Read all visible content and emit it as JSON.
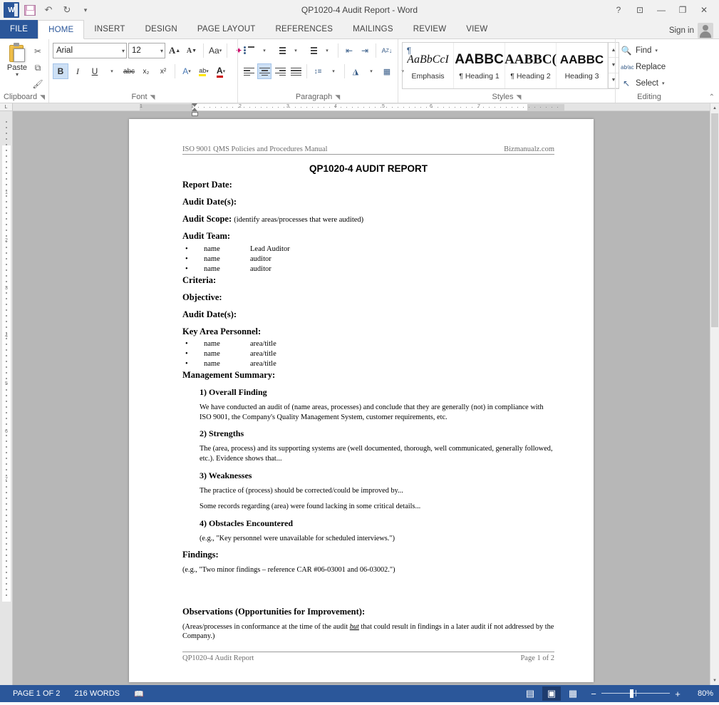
{
  "titlebar": {
    "app_logo": "word-logo",
    "title": "QP1020-4 Audit Report - Word",
    "quick_access": [
      {
        "name": "save-icon",
        "label": "Save"
      },
      {
        "name": "undo-icon",
        "label": "↶"
      },
      {
        "name": "redo-icon",
        "label": "↻"
      },
      {
        "name": "customize-qat-icon",
        "label": "⩒"
      }
    ],
    "window_controls": [
      {
        "name": "help-icon",
        "label": "?"
      },
      {
        "name": "ribbon-display-options-icon",
        "label": "⊡"
      },
      {
        "name": "minimize-icon",
        "label": "—"
      },
      {
        "name": "restore-icon",
        "label": "❐"
      },
      {
        "name": "close-icon",
        "label": "✕"
      }
    ]
  },
  "tabs": {
    "file": "FILE",
    "items": [
      "HOME",
      "INSERT",
      "DESIGN",
      "PAGE LAYOUT",
      "REFERENCES",
      "MAILINGS",
      "REVIEW",
      "VIEW"
    ],
    "active": "HOME",
    "sign_in": "Sign in"
  },
  "ribbon": {
    "clipboard": {
      "label": "Clipboard",
      "paste": "Paste",
      "paste_caret": "▾",
      "cut": "✂",
      "copy": "⧉",
      "format_painter": "🖌",
      "dialog_launcher": "◥"
    },
    "font": {
      "label": "Font",
      "font_name": "Arial",
      "font_size": "12",
      "grow_font": "A",
      "shrink_font": "A",
      "change_case": "Aa",
      "clear_formatting": "✐",
      "bold": "B",
      "italic": "I",
      "underline": "U",
      "strikethrough": "abc",
      "subscript": "x₂",
      "superscript": "x²",
      "text_effects": "A",
      "highlight": "ab",
      "font_color": "A",
      "dialog_launcher": "◥",
      "bold_active": true
    },
    "paragraph": {
      "label": "Paragraph",
      "bullets": "bullet-list-icon",
      "numbering": "numbered-list-icon",
      "multilevel": "multilevel-list-icon",
      "decrease_indent": "⇤",
      "increase_indent": "⇥",
      "sort": "A Z↓",
      "show_marks": "¶",
      "align_left": "align-left-icon",
      "align_center": "align-center-icon",
      "align_right": "align-right-icon",
      "justify": "justify-icon",
      "line_spacing": "line-spacing-icon",
      "shading": "shading-icon",
      "borders": "borders-icon",
      "dialog_launcher": "◥",
      "align_center_active": true
    },
    "styles": {
      "label": "Styles",
      "dialog_launcher": "◥",
      "items": [
        {
          "preview": "AaBbCcI",
          "name": "Emphasis",
          "kind": "emph"
        },
        {
          "preview": "AABBC",
          "name": "¶ Heading 1",
          "kind": "h1"
        },
        {
          "preview": "AABBC(",
          "name": "¶ Heading 2",
          "kind": "h2"
        },
        {
          "preview": "AABBC",
          "name": "Heading 3",
          "kind": "h3"
        }
      ],
      "scroll_up": "▲",
      "scroll_down": "▼",
      "more": "▼"
    },
    "editing": {
      "label": "Editing",
      "find": "Find",
      "find_caret": "▾",
      "replace": "Replace",
      "select": "Select",
      "select_caret": "▾",
      "collapse_ribbon": "⌃"
    }
  },
  "rulers": {
    "corner_label": "L",
    "horizontal_ticks": [
      "1",
      "1",
      "2",
      "3",
      "4",
      "5",
      "6",
      "7"
    ],
    "vertical_ticks": [
      "1",
      "2",
      "3",
      "4",
      "5",
      "6",
      "7"
    ]
  },
  "document": {
    "header": {
      "left": "ISO 9001 QMS Policies and Procedures Manual",
      "right": "Bizmanualz.com"
    },
    "title": "QP1020-4 AUDIT REPORT",
    "fields": [
      {
        "label": "Report Date:",
        "hint": ""
      },
      {
        "label": "Audit Date(s):",
        "hint": ""
      },
      {
        "label": "Audit Scope:",
        "hint": "(identify areas/processes that were audited)"
      }
    ],
    "audit_team": {
      "label": "Audit Team:",
      "rows": [
        {
          "name": "name",
          "role": "Lead Auditor"
        },
        {
          "name": "name",
          "role": "auditor"
        },
        {
          "name": "name",
          "role": "auditor"
        }
      ]
    },
    "fields2": [
      {
        "label": "Criteria:",
        "hint": ""
      },
      {
        "label": "Objective:",
        "hint": ""
      },
      {
        "label": "Audit Date(s):",
        "hint": ""
      }
    ],
    "key_personnel": {
      "label": "Key Area Personnel:",
      "rows": [
        {
          "name": "name",
          "role": "area/title"
        },
        {
          "name": "name",
          "role": "area/title"
        },
        {
          "name": "name",
          "role": "area/title"
        }
      ]
    },
    "management_summary": {
      "label": "Management Summary:",
      "sections": [
        {
          "heading": "1) Overall Finding",
          "paragraphs": [
            "We have conducted an audit of (name areas, processes) and conclude that they are generally (not) in compliance with ISO 9001, the Company's Quality Management System, customer requirements, etc."
          ]
        },
        {
          "heading": "2) Strengths",
          "paragraphs": [
            "The (area, process) and its supporting systems are (well documented, thorough, well communicated, generally followed, etc.).  Evidence shows that..."
          ]
        },
        {
          "heading": "3) Weaknesses",
          "paragraphs": [
            "The practice of (process) should be corrected/could be improved by...",
            "Some records regarding (area) were found lacking in some critical details..."
          ]
        },
        {
          "heading": "4) Obstacles Encountered",
          "paragraphs": [
            "(e.g., \"Key personnel were unavailable for scheduled interviews.\")"
          ]
        }
      ]
    },
    "findings": {
      "label": "Findings:",
      "text": "(e.g., \"Two minor findings – reference CAR #06-03001 and 06-03002.\")"
    },
    "observations": {
      "label": "Observations (Opportunities for Improvement):",
      "text_before": "(Areas/processes in conformance at the time of the audit ",
      "emphasis": "but",
      "text_after": " that could result in findings in a later audit if not addressed by the Company.)"
    },
    "footer": {
      "left": "QP1020-4 Audit Report",
      "right": "Page 1 of 2"
    }
  },
  "statusbar": {
    "page": "PAGE 1 OF 2",
    "words": "216 WORDS",
    "proofing_icon": "proofing-errors-icon",
    "views": [
      {
        "name": "read-mode-icon",
        "glyph": "▤",
        "active": false
      },
      {
        "name": "print-layout-icon",
        "glyph": "▣",
        "active": true
      },
      {
        "name": "web-layout-icon",
        "glyph": "▦",
        "active": false
      }
    ],
    "zoom_out": "−",
    "zoom_in": "+",
    "zoom_level": "80%"
  }
}
